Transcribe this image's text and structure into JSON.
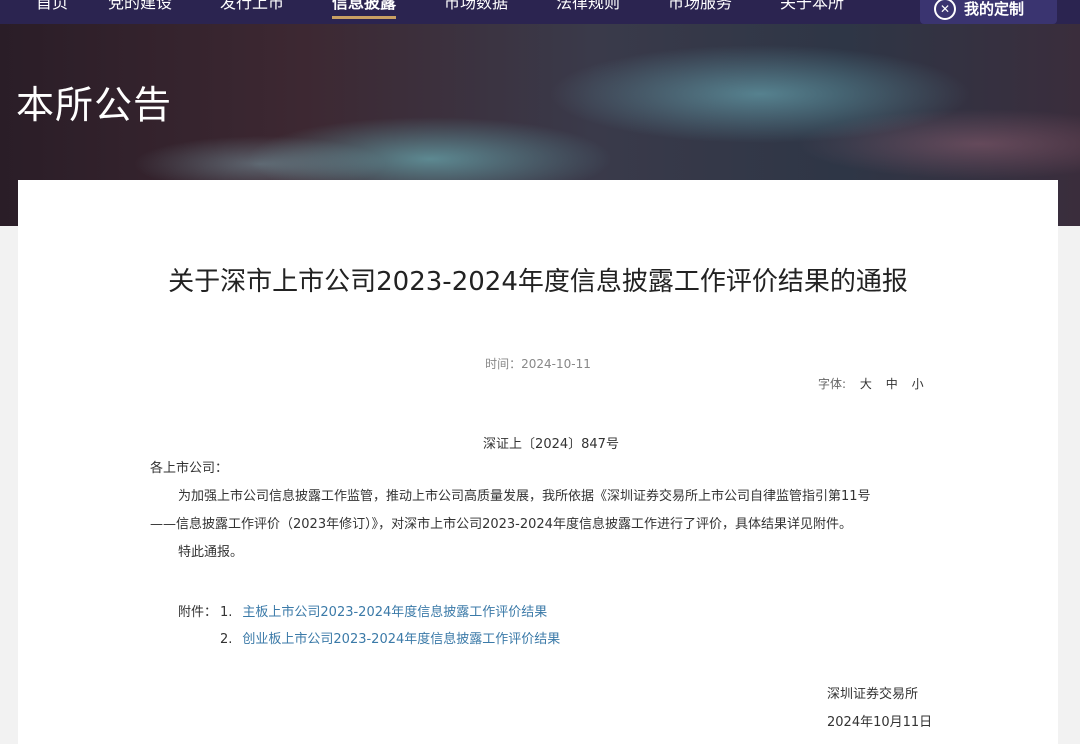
{
  "nav": {
    "items": [
      {
        "label": "首页"
      },
      {
        "label": "党的建设"
      },
      {
        "label": "发行上市"
      },
      {
        "label": "信息披露",
        "active": true
      },
      {
        "label": "市场数据"
      },
      {
        "label": "法律规则"
      },
      {
        "label": "市场服务"
      },
      {
        "label": "关于本所"
      }
    ],
    "button_label": "我的定制",
    "button_icon": "close-circle-icon"
  },
  "banner": {
    "title": "本所公告"
  },
  "article": {
    "title": "关于深市上市公司2023-2024年度信息披露工作评价结果的通报",
    "time": "时间：2024-10-11",
    "fontsize_label": "字体:",
    "fontsize_options": [
      "大",
      "中",
      "小"
    ],
    "doc_number": "深证上〔2024〕847号",
    "salutation": "各上市公司：",
    "paragraph_line1": "为加强上市公司信息披露工作监管，推动上市公司高质量发展，我所依据《深圳证券交易所上市公司自律监管指引第11号",
    "paragraph_line2": "——信息披露工作评价（2023年修订）》，对深市上市公司2023-2024年度信息披露工作进行了评价，具体结果详见附件。",
    "closing": "特此通报。",
    "attachments_label": "附件：",
    "attachments": [
      {
        "num": "1.",
        "title": "主板上市公司2023-2024年度信息披露工作评价结果"
      },
      {
        "num": "2.",
        "title": "创业板上市公司2023-2024年度信息披露工作评价结果"
      }
    ],
    "signature": "深圳证券交易所",
    "sign_date": "2024年10月11日"
  },
  "colors": {
    "nav_bg": "#2b2450",
    "link": "#3b7aa8",
    "active_underline": "#c9a063"
  }
}
